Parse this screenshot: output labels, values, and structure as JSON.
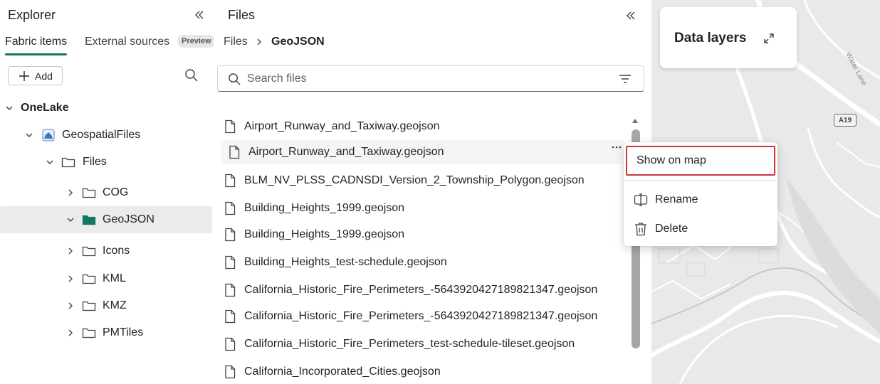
{
  "explorer": {
    "title": "Explorer",
    "tabs": [
      {
        "label": "Fabric items",
        "active": true
      },
      {
        "label": "External sources",
        "active": false
      }
    ],
    "preview_badge": "Preview",
    "add_label": "Add",
    "tree": [
      {
        "label": "OneLake",
        "level": 0,
        "expanded": true,
        "icon": "none"
      },
      {
        "label": "GeospatialFiles",
        "level": 1,
        "expanded": true,
        "icon": "lakehouse-icon"
      },
      {
        "label": "Files",
        "level": 2,
        "expanded": true,
        "icon": "folder-icon"
      },
      {
        "label": "COG",
        "level": 3,
        "expanded": false,
        "icon": "folder-icon"
      },
      {
        "label": "GeoJSON",
        "level": 3,
        "expanded": true,
        "icon": "folder-filled-icon",
        "selected": true
      },
      {
        "label": "Icons",
        "level": 3,
        "expanded": false,
        "icon": "folder-icon"
      },
      {
        "label": "KML",
        "level": 3,
        "expanded": false,
        "icon": "folder-icon"
      },
      {
        "label": "KMZ",
        "level": 3,
        "expanded": false,
        "icon": "folder-icon"
      },
      {
        "label": "PMTiles",
        "level": 3,
        "expanded": false,
        "icon": "folder-icon"
      }
    ]
  },
  "files": {
    "title": "Files",
    "breadcrumb": [
      "Files",
      "GeoJSON"
    ],
    "search_placeholder": "Search files",
    "items": [
      "Airport_Runway_and_Taxiway.geojson",
      "Airport_Runway_and_Taxiway.geojson",
      "BLM_NV_PLSS_CADNSDI_Version_2_Township_Polygon.geojson",
      "Building_Heights_1999.geojson",
      "Building_Heights_1999.geojson",
      "Building_Heights_test-schedule.geojson",
      "California_Historic_Fire_Perimeters_-5643920427189821347.geojson",
      "California_Historic_Fire_Perimeters_-5643920427189821347.geojson",
      "California_Historic_Fire_Perimeters_test-schedule-tileset.geojson",
      "California_Incorporated_Cities.geojson"
    ],
    "more_label": "..."
  },
  "context_menu": {
    "items": [
      {
        "label": "Show on map",
        "icon": "none",
        "highlighted": true
      },
      {
        "label": "Rename",
        "icon": "rename-icon"
      },
      {
        "label": "Delete",
        "icon": "trash-icon"
      }
    ]
  },
  "map": {
    "data_layers_title": "Data layers",
    "road_sign": "A19",
    "street_label": "Water Lane"
  },
  "colors": {
    "accent": "#117865",
    "highlight_border": "#d13438",
    "map_bg": "#e9e9e9"
  }
}
